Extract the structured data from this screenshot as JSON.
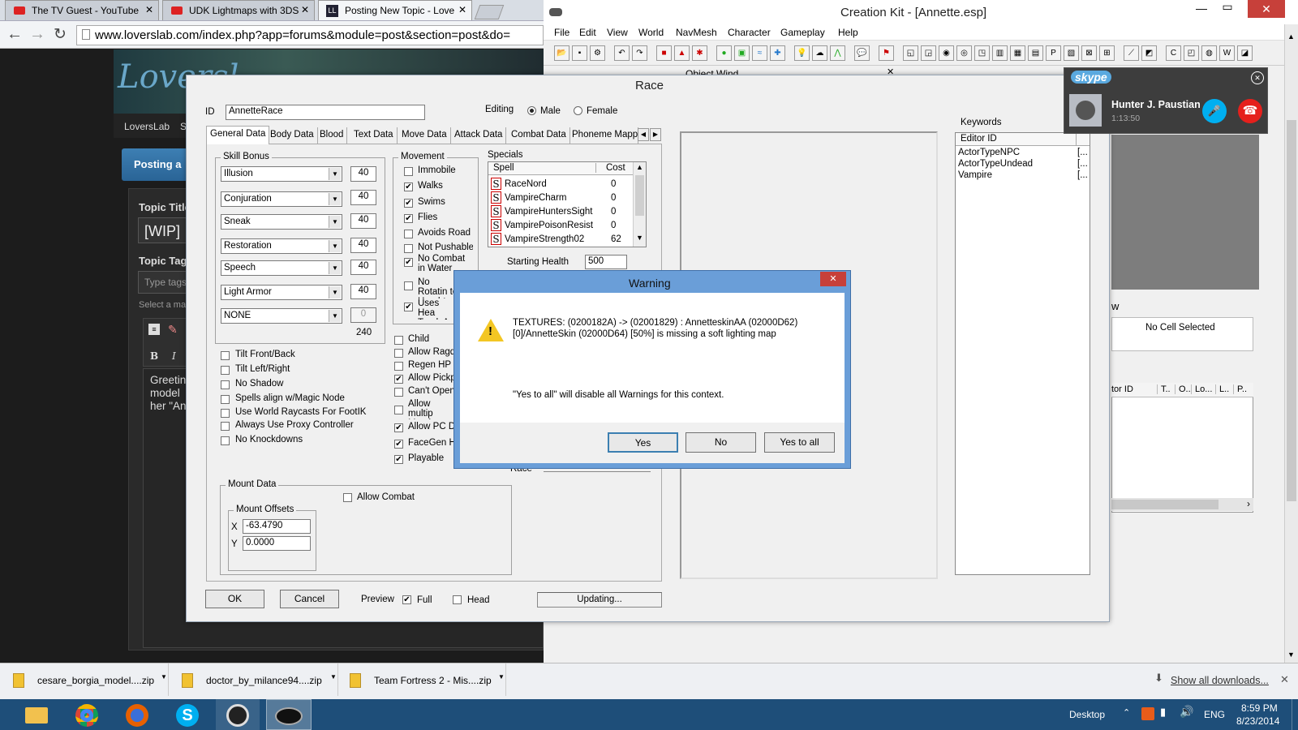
{
  "browser": {
    "tabs": [
      {
        "label": "The TV Guest - YouTube"
      },
      {
        "label": "UDK Lightmaps with 3DS"
      },
      {
        "label": "Posting New Topic - Love"
      }
    ],
    "url": "www.loverslab.com/index.php?app=forums&module=post&section=post&do=",
    "site_logo": "Loversl",
    "nav_item": "LoversLab",
    "nav_item_2": "S",
    "panel_title": "Posting a",
    "topic_title_label": "Topic Title",
    "topic_title_value": "[WIP]",
    "topic_tags_label": "Topic Tag",
    "tags_placeholder": "Type tags",
    "select_text": "Select a ma",
    "editor_text": [
      "Greetin",
      "model",
      "her \"An"
    ]
  },
  "ck": {
    "title": "Creation Kit - [Annette.esp]",
    "menu": [
      "File",
      "Edit",
      "View",
      "World",
      "NavMesh",
      "Character",
      "Gameplay",
      "Help"
    ],
    "object_window_label": "Object Wind",
    "cell_view_label": "w",
    "no_cell": "No Cell Selected",
    "cell_cols": [
      "tor ID",
      "T..",
      "O..",
      "Lo...",
      "L..",
      "P.."
    ]
  },
  "race": {
    "title": "Race",
    "id_label": "ID",
    "id_value": "AnnetteRace",
    "editing_label": "Editing",
    "male": "Male",
    "female": "Female",
    "tabs": [
      "General Data",
      "Body Data",
      "Blood",
      "Text Data",
      "Move Data",
      "Attack Data",
      "Combat Data",
      "Phoneme Mappi"
    ],
    "skill_bonus_label": "Skill Bonus",
    "skills": [
      {
        "name": "Illusion",
        "value": "40"
      },
      {
        "name": "Conjuration",
        "value": "40"
      },
      {
        "name": "Sneak",
        "value": "40"
      },
      {
        "name": "Restoration",
        "value": "40"
      },
      {
        "name": "Speech",
        "value": "40"
      },
      {
        "name": "Light Armor",
        "value": "40"
      },
      {
        "name": "NONE",
        "value": "0"
      }
    ],
    "skill_total": "240",
    "movement_label": "Movement",
    "movement": [
      {
        "label": "Immobile",
        "checked": ""
      },
      {
        "label": "Walks",
        "checked": "✔"
      },
      {
        "label": "Swims",
        "checked": "✔"
      },
      {
        "label": "Flies",
        "checked": "✔"
      },
      {
        "label": "Avoids Road",
        "checked": ""
      },
      {
        "label": "Not Pushable",
        "checked": ""
      },
      {
        "label": "No Combat in Water",
        "checked": "✔"
      },
      {
        "label": "No Rotatin to Head-t",
        "checked": ""
      },
      {
        "label": "Uses Hea Track An",
        "checked": "✔"
      }
    ],
    "flags_mid": [
      {
        "label": "Child",
        "checked": ""
      },
      {
        "label": "Allow Ragdo",
        "checked": ""
      },
      {
        "label": "Regen HP i",
        "checked": ""
      },
      {
        "label": "Allow Pickp",
        "checked": "✔"
      },
      {
        "label": "Can't Open",
        "checked": ""
      },
      {
        "label": "Allow multip Membrane S",
        "checked": ""
      },
      {
        "label": "Allow PC Di",
        "checked": "✔"
      },
      {
        "label": "FaceGen He",
        "checked": "✔"
      },
      {
        "label": "Playable",
        "checked": "✔"
      }
    ],
    "flags_left": [
      {
        "label": "Tilt Front/Back",
        "checked": ""
      },
      {
        "label": "Tilt Left/Right",
        "checked": ""
      },
      {
        "label": "No Shadow",
        "checked": ""
      },
      {
        "label": "Spells align w/Magic Node",
        "checked": ""
      },
      {
        "label": "Use World Raycasts For FootIK",
        "checked": ""
      },
      {
        "label": "Always Use Proxy Controller",
        "checked": ""
      },
      {
        "label": "No Knockdowns",
        "checked": ""
      }
    ],
    "specials_label": "Specials",
    "specials_cols": [
      "Spell",
      "Cost"
    ],
    "specials": [
      {
        "spell": "RaceNord",
        "cost": "0"
      },
      {
        "spell": "VampireCharm",
        "cost": "0"
      },
      {
        "spell": "VampireHuntersSight",
        "cost": "0"
      },
      {
        "spell": "VampirePoisonResist",
        "cost": "0"
      },
      {
        "spell": "VampireStrength02",
        "cost": "62"
      }
    ],
    "starting_health_label": "Starting Health",
    "starting_health": "500",
    "race_label": "Race",
    "mount_data_label": "Mount Data",
    "allow_combat": "Allow Combat",
    "mount_offsets_label": "Mount Offsets",
    "x_label": "X",
    "x_value": "-63.4790",
    "y_label": "Y",
    "y_value": "0.0000",
    "ok": "OK",
    "cancel": "Cancel",
    "preview_label": "Preview",
    "full": "Full",
    "head": "Head",
    "status": "Updating...",
    "keywords_label": "Keywords",
    "keywords_col": "Editor ID",
    "keywords": [
      "ActorTypeNPC",
      "ActorTypeUndead",
      "Vampire"
    ]
  },
  "warning": {
    "title": "Warning",
    "message": "TEXTURES:  (0200182A) ->  (02001829) : AnnetteskinAA (02000D62)[0]/AnnetteSkin (02000D64) [50%] is missing a soft lighting map",
    "note": "\"Yes to all\" will disable all Warnings for this context.",
    "yes": "Yes",
    "no": "No",
    "yes_all": "Yes to all"
  },
  "skype": {
    "brand": "skype",
    "caller": "Hunter J. Paustian",
    "duration": "1:13:50"
  },
  "downloads": {
    "items": [
      "cesare_borgia_model....zip",
      "doctor_by_milance94....zip",
      "Team Fortress 2 - Mis....zip"
    ],
    "show_all": "Show all downloads..."
  },
  "taskbar": {
    "desktop": "Desktop",
    "lang": "ENG",
    "time": "8:59 PM",
    "date": "8/23/2014"
  },
  "colors": {
    "taskbar": "#1e4e79",
    "dialog_frame": "#6a9ed8",
    "close_red": "#c7403a",
    "skype_blue": "#00aff0"
  }
}
